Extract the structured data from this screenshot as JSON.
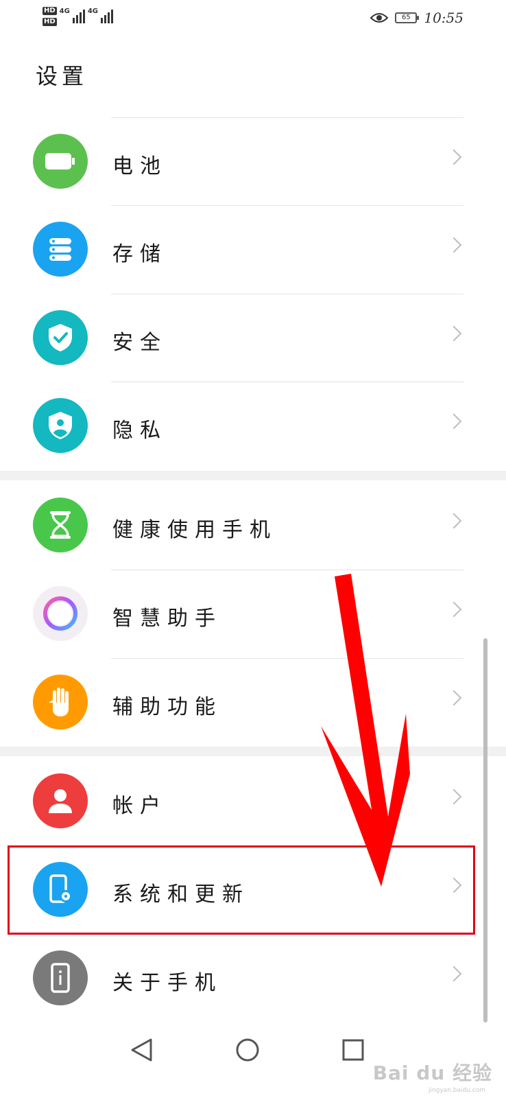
{
  "status_bar": {
    "hd1": "HD",
    "hd2": "HD",
    "net1": "4G",
    "net2": "4G",
    "battery": "65",
    "time": "10:55",
    "eye_icon": "eye-icon"
  },
  "page": {
    "title": "设置"
  },
  "items": [
    {
      "label": "电池",
      "icon": "battery-icon",
      "color": "#5cc04e"
    },
    {
      "label": "存储",
      "icon": "storage-icon",
      "color": "#1aa3f0"
    },
    {
      "label": "安全",
      "icon": "shield-check-icon",
      "color": "#13b8c0"
    },
    {
      "label": "隐私",
      "icon": "privacy-shield-icon",
      "color": "#13b8c0"
    },
    {
      "label": "健康使用手机",
      "icon": "hourglass-icon",
      "color": "#49c74a"
    },
    {
      "label": "智慧助手",
      "icon": "assistant-orb-icon",
      "color": "#f3eef3"
    },
    {
      "label": "辅助功能",
      "icon": "hand-icon",
      "color": "#ff9b00"
    },
    {
      "label": "帐户",
      "icon": "account-icon",
      "color": "#ee3d3d"
    },
    {
      "label": "系统和更新",
      "icon": "system-update-icon",
      "color": "#1aa3f0"
    },
    {
      "label": "关于手机",
      "icon": "phone-info-icon",
      "color": "#7a7a7a"
    }
  ],
  "annotation": {
    "highlight_color": "#e0001b",
    "highlighted_item": "系统和更新"
  },
  "nav": {
    "back": "back-icon",
    "home": "home-icon",
    "recents": "recents-icon"
  },
  "watermark": {
    "brand": "Bai du 经验",
    "site": "jingyan.baidu.com"
  }
}
